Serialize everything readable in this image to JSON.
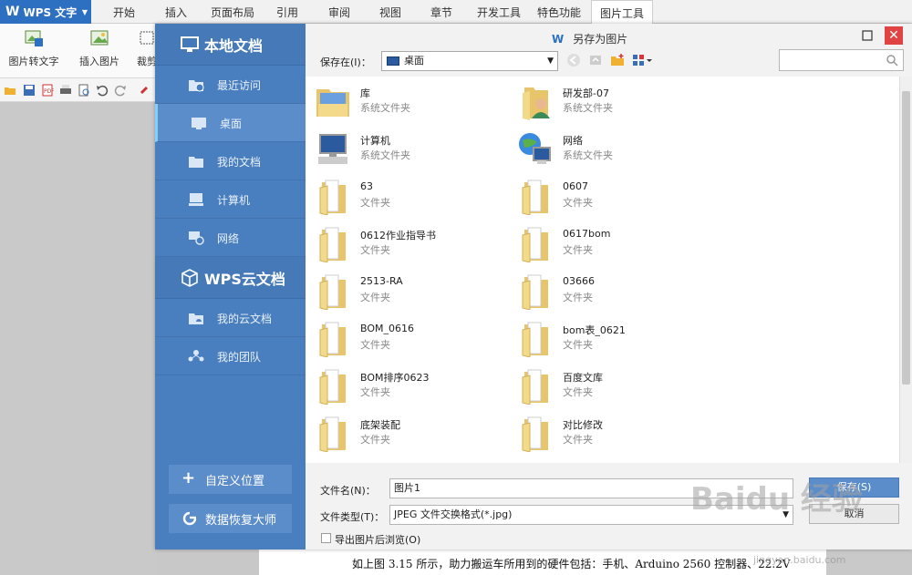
{
  "app": {
    "logo": "WPS 文字"
  },
  "menu_tabs": [
    "开始",
    "插入",
    "页面布局",
    "引用",
    "审阅",
    "视图",
    "章节",
    "开发工具",
    "特色功能",
    "图片工具"
  ],
  "ribbon": {
    "btn1": "图片转文字",
    "btn2": "插入图片",
    "btn3": "裁剪"
  },
  "dialog": {
    "title": "另存为图片",
    "sidebar": {
      "local_header": "本地文档",
      "items": [
        "最近访问",
        "桌面",
        "我的文档",
        "计算机",
        "网络"
      ],
      "cloud_header": "WPS云文档",
      "cloud_items": [
        "我的云文档",
        "我的团队"
      ],
      "custom_button": "自定义位置",
      "recovery_button": "数据恢复大师"
    },
    "save_in_label": "保存在(I)：",
    "save_in_value": "桌面",
    "files": [
      {
        "name": "库",
        "type": "系统文件夹",
        "icon": "library"
      },
      {
        "name": "研发部-07",
        "type": "系统文件夹",
        "icon": "user"
      },
      {
        "name": "计算机",
        "type": "系统文件夹",
        "icon": "computer"
      },
      {
        "name": "网络",
        "type": "系统文件夹",
        "icon": "network"
      },
      {
        "name": "63",
        "type": "文件夹",
        "icon": "folder"
      },
      {
        "name": "0607",
        "type": "文件夹",
        "icon": "folder"
      },
      {
        "name": "0612作业指导书",
        "type": "文件夹",
        "icon": "folder"
      },
      {
        "name": "0617bom",
        "type": "文件夹",
        "icon": "folder"
      },
      {
        "name": "2513-RA",
        "type": "文件夹",
        "icon": "folder"
      },
      {
        "name": "03666",
        "type": "文件夹",
        "icon": "folder"
      },
      {
        "name": "BOM_0616",
        "type": "文件夹",
        "icon": "folder"
      },
      {
        "name": "bom表_0621",
        "type": "文件夹",
        "icon": "folder"
      },
      {
        "name": "BOM排序0623",
        "type": "文件夹",
        "icon": "folder"
      },
      {
        "name": "百度文库",
        "type": "文件夹",
        "icon": "folder"
      },
      {
        "name": "底架装配",
        "type": "文件夹",
        "icon": "folder"
      },
      {
        "name": "对比修改",
        "type": "文件夹",
        "icon": "folder"
      }
    ],
    "filename_label": "文件名(N)：",
    "filename_value": "图片1",
    "filetype_label": "文件类型(T)：",
    "filetype_value": "JPEG 文件交换格式(*.jpg)",
    "save_button": "保存(S)",
    "cancel_button": "取消",
    "preview_checkbox": "导出图片后浏览(O)"
  },
  "document": {
    "text": "如上图 3.15 所示，助力搬运车所用到的硬件包括：手机、Arduino 2560 控制器、22.2V"
  },
  "watermark": {
    "main": "Baidu 经验",
    "sub": "jingyan.baidu.com"
  }
}
